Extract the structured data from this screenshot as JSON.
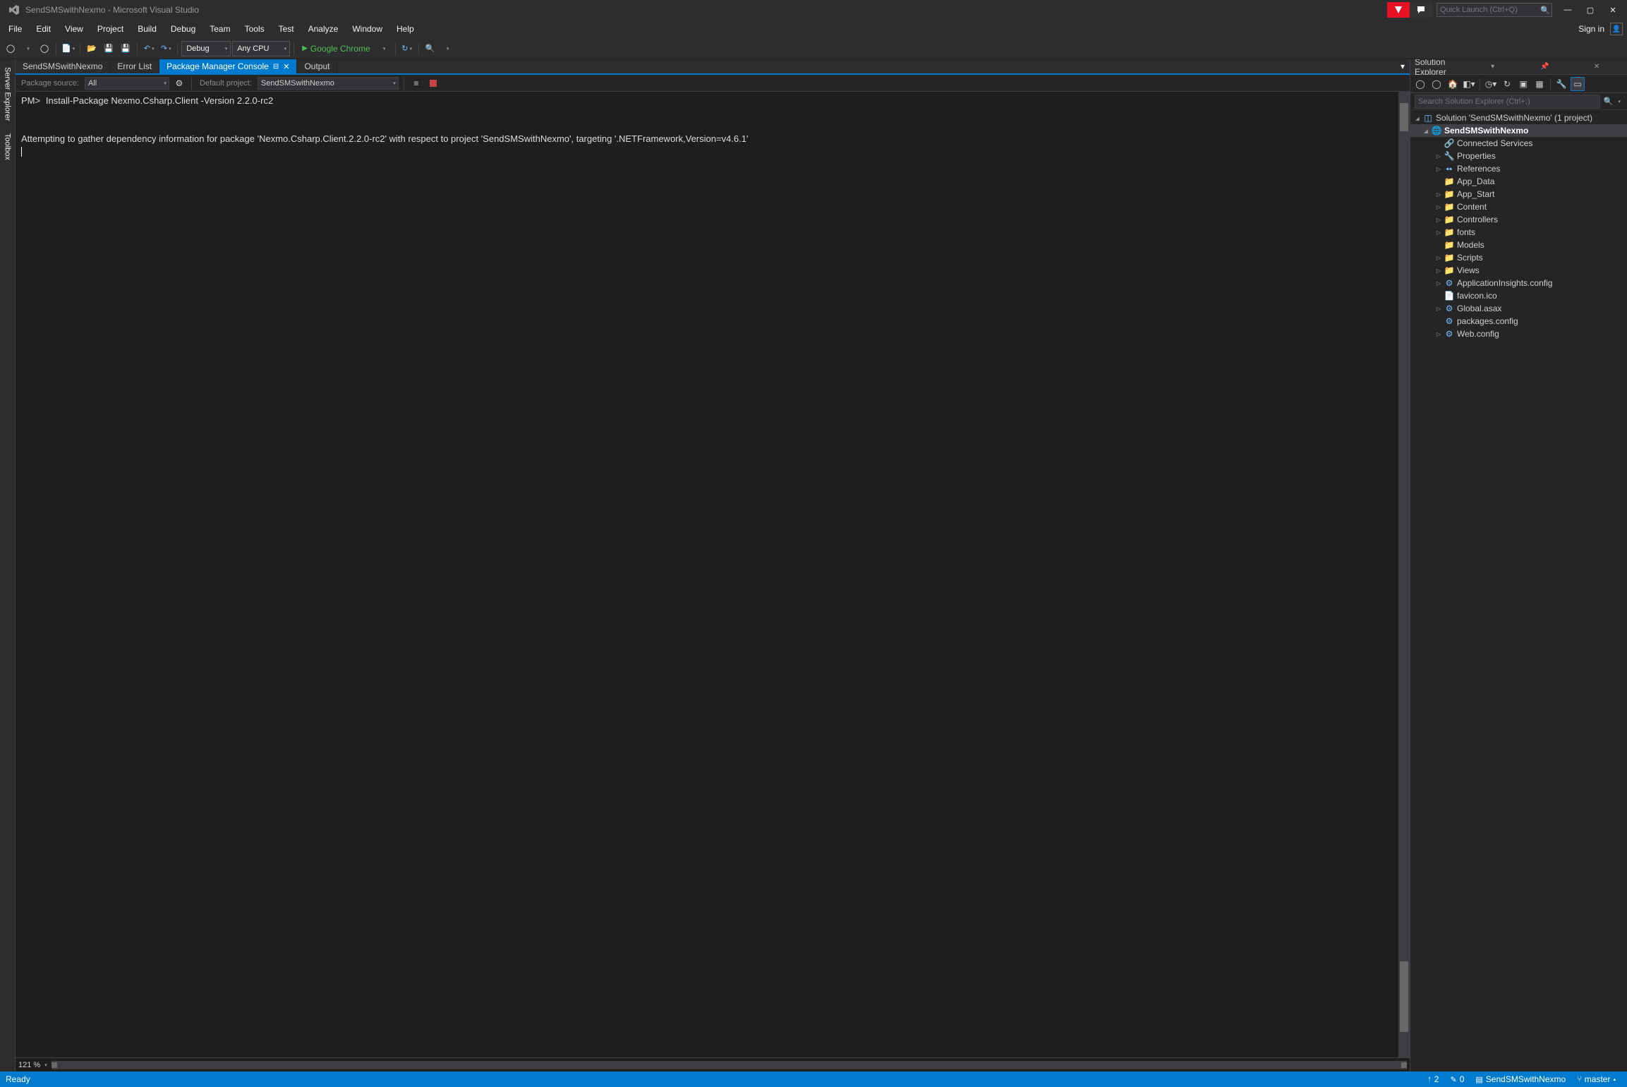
{
  "title": "SendSMSwithNexmo - Microsoft Visual Studio",
  "quicklaunch_placeholder": "Quick Launch (Ctrl+Q)",
  "menu": [
    "File",
    "Edit",
    "View",
    "Project",
    "Build",
    "Debug",
    "Team",
    "Tools",
    "Test",
    "Analyze",
    "Window",
    "Help"
  ],
  "signin": "Sign in",
  "toolbar": {
    "config": "Debug",
    "platform": "Any CPU",
    "start": "Google Chrome"
  },
  "leftrail": [
    "Server Explorer",
    "Toolbox"
  ],
  "tabs": [
    {
      "label": "SendSMSwithNexmo",
      "active": false,
      "closable": false
    },
    {
      "label": "Error List",
      "active": false,
      "closable": false
    },
    {
      "label": "Package Manager Console",
      "active": true,
      "closable": true,
      "pin": true
    },
    {
      "label": "Output",
      "active": false,
      "closable": false
    }
  ],
  "pmc": {
    "source_label": "Package source:",
    "source_value": "All",
    "project_label": "Default project:",
    "project_value": "SendSMSwithNexmo",
    "prompt": "PM>",
    "command": "Install-Package Nexmo.Csharp.Client -Version 2.2.0-rc2",
    "output": "Attempting to gather dependency information for package 'Nexmo.Csharp.Client.2.2.0-rc2' with respect to project 'SendSMSwithNexmo', targeting '.NETFramework,Version=v4.6.1'"
  },
  "zoom": "121 %",
  "solution_explorer": {
    "title": "Solution Explorer",
    "search_placeholder": "Search Solution Explorer (Ctrl+;)",
    "solution_text": "Solution 'SendSMSwithNexmo' (1 project)",
    "project": "SendSMSwithNexmo",
    "items": [
      {
        "label": "Connected Services",
        "icon": "link",
        "exp": "none",
        "indent": 2
      },
      {
        "label": "Properties",
        "icon": "wrench",
        "exp": "closed",
        "indent": 2
      },
      {
        "label": "References",
        "icon": "refs",
        "exp": "closed",
        "indent": 2
      },
      {
        "label": "App_Data",
        "icon": "folder",
        "exp": "none",
        "indent": 2
      },
      {
        "label": "App_Start",
        "icon": "folder",
        "exp": "closed",
        "indent": 2
      },
      {
        "label": "Content",
        "icon": "folder",
        "exp": "closed",
        "indent": 2
      },
      {
        "label": "Controllers",
        "icon": "folder",
        "exp": "closed",
        "indent": 2
      },
      {
        "label": "fonts",
        "icon": "folder",
        "exp": "closed",
        "indent": 2
      },
      {
        "label": "Models",
        "icon": "folder",
        "exp": "none",
        "indent": 2
      },
      {
        "label": "Scripts",
        "icon": "folder",
        "exp": "closed",
        "indent": 2
      },
      {
        "label": "Views",
        "icon": "folder",
        "exp": "closed",
        "indent": 2
      },
      {
        "label": "ApplicationInsights.config",
        "icon": "config",
        "exp": "closed",
        "indent": 2
      },
      {
        "label": "favicon.ico",
        "icon": "file",
        "exp": "none",
        "indent": 2
      },
      {
        "label": "Global.asax",
        "icon": "config",
        "exp": "closed",
        "indent": 2
      },
      {
        "label": "packages.config",
        "icon": "config",
        "exp": "none",
        "indent": 2
      },
      {
        "label": "Web.config",
        "icon": "config",
        "exp": "closed",
        "indent": 2
      }
    ]
  },
  "status": {
    "ready": "Ready",
    "up": "2",
    "pencil": "0",
    "project": "SendSMSwithNexmo",
    "branch": "master"
  }
}
